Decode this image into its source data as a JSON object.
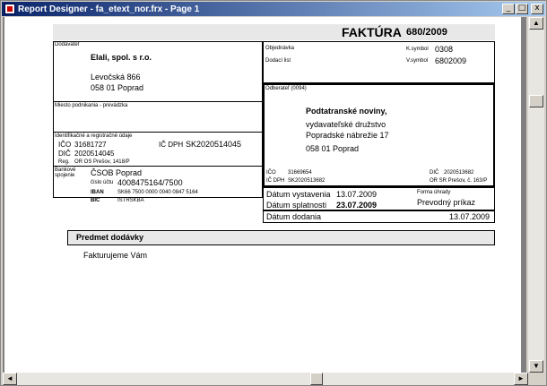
{
  "window": {
    "title": "Report Designer - fa_etext_nor.frx - Page 1",
    "minimize": "_",
    "maximize": "□",
    "close": "x"
  },
  "invoice": {
    "header_title": "FAKTÚRA",
    "header_number": "680/2009",
    "supplier_label": "Dodávateľ",
    "supplier_name": "Elali, spol. s r.o.",
    "supplier_street": "Levočská 866",
    "supplier_city": "058 01   Poprad",
    "place_label": "Miesto podnikania - prevádzka",
    "ident_label": "Identifikačné a registračné údaje",
    "ico_label": "IČO",
    "ico_value": "31681727",
    "icdph_label": "IČ DPH",
    "icdph_value": "SK2020514045",
    "dic_label": "DIČ",
    "dic_value": "2020514045",
    "reg_label": "Reg.",
    "reg_value": "OR OS Prešov, 1418/P",
    "bank_label1": "Bankové",
    "bank_label2": "spojenie",
    "bank_name": "ČSOB Poprad",
    "account_label": "číslo účtu",
    "account_value": "4008475164/7500",
    "iban_label": "IBAN",
    "iban_value": "SK66 7500 0000 0040 0847 5164",
    "bic_label": "BIC",
    "bic_value": "ISTRSKBA",
    "order_label": "Objednávka",
    "delivery_note_label": "Dodací list",
    "ksymbol_label": "K.symbol",
    "ksymbol_value": "0308",
    "vsymbol_label": "V.symbol",
    "vsymbol_value": "6802009",
    "customer_label": "Odberateľ (0094)",
    "customer_name": "Podtatranské noviny,",
    "customer_line2": "vydavateľské družstvo",
    "customer_street": "Popradské nábrežie 17",
    "customer_city": "058 01    Poprad",
    "cust_ico_label": "IČO",
    "cust_ico_value": "31669654",
    "cust_dic_label": "DIČ",
    "cust_dic_value": "2020513682",
    "cust_icdph_label": "IČ DPH",
    "cust_icdph_value": "SK2020513682",
    "cust_reg_value": "OR SR Prešov, č. 163/P",
    "issue_label": "Dátum vystavenia",
    "issue_value": "13.07.2009",
    "due_label": "Dátum splatnosti",
    "due_value": "23.07.2009",
    "payment_label": "Forma úhrady",
    "payment_value": "Prevodný príkaz",
    "delivery_label": "Dátum dodania",
    "delivery_value": "13.07.2009",
    "subject_label": "Predmet  dodávky",
    "body_text": "Fakturujeme Vám"
  }
}
